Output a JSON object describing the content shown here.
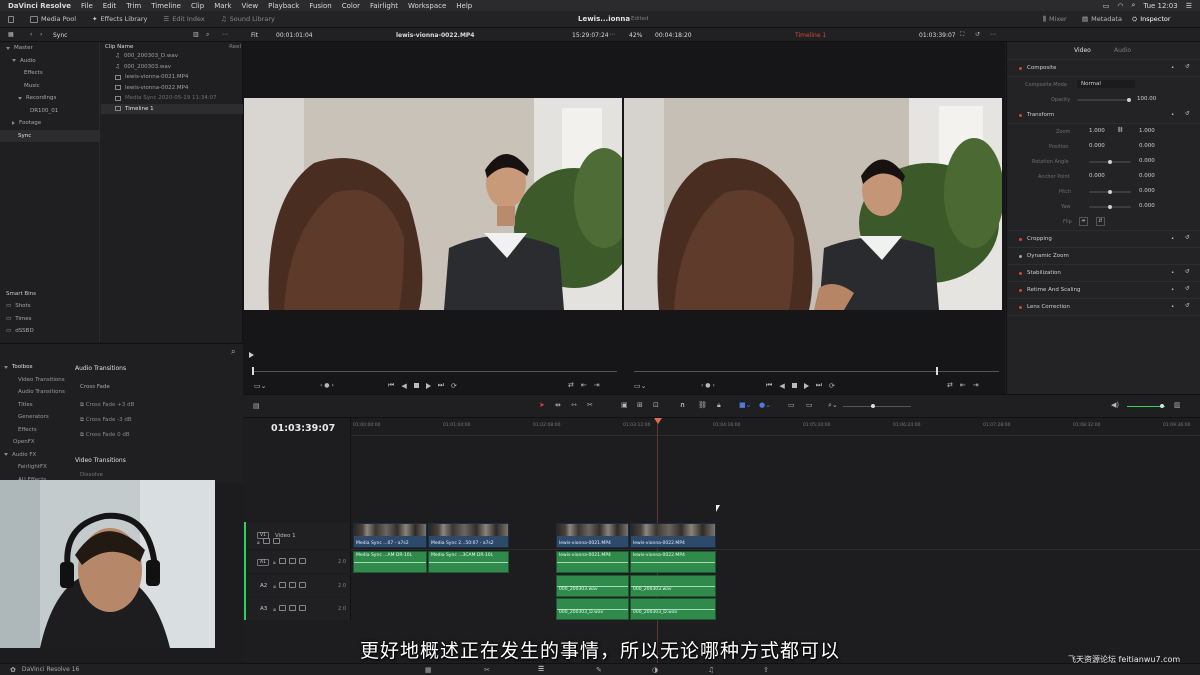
{
  "menubar": {
    "app_name": "DaVinci Resolve",
    "items": [
      "File",
      "Edit",
      "Trim",
      "Timeline",
      "Clip",
      "Mark",
      "View",
      "Playback",
      "Fusion",
      "Color",
      "Fairlight",
      "Workspace",
      "Help"
    ],
    "clock": "Tue 12:03"
  },
  "toolbar": {
    "media_pool": "Media Pool",
    "effects_library": "Effects Library",
    "edit_index": "Edit Index",
    "sound_library": "Sound Library",
    "project_title": "Lewis...ionna",
    "project_status": "Edited",
    "mixer": "Mixer",
    "metadata": "Metadata",
    "inspector": "Inspector"
  },
  "viewerbar": {
    "bin_name": "Sync",
    "fit": "Fit",
    "source_tc_left": "00:01:01:04",
    "source_clip": "lewis-vionna-0022.MP4",
    "source_tc_right": "15:29:07:24",
    "zoom": "42%",
    "duration": "00:04:18:20",
    "timeline_name": "Timeline 1",
    "program_tc": "01:03:39:07"
  },
  "bins": {
    "items": [
      {
        "label": "Master",
        "depth": 0,
        "expanded": true
      },
      {
        "label": "Audio",
        "depth": 1,
        "expanded": true
      },
      {
        "label": "Effects",
        "depth": 2
      },
      {
        "label": "Music",
        "depth": 2
      },
      {
        "label": "Recordings",
        "depth": 2,
        "expanded": true
      },
      {
        "label": "DR100_01",
        "depth": 3
      },
      {
        "label": "Footage",
        "depth": 1
      },
      {
        "label": "Sync",
        "depth": 1,
        "selected": true
      }
    ],
    "smart_bins_label": "Smart Bins",
    "smart_bins": [
      "Shots",
      "Times",
      "dSSBD"
    ]
  },
  "cliplist": {
    "header_name": "Clip Name",
    "header_reel": "Reel",
    "clips": [
      "000_200303_D.wav",
      "000_200303.wav",
      "lewis-vionna-0021.MP4",
      "lewis-vionna-0022.MP4",
      "Media Sync 2020-05-19 11:34:07",
      "Timeline 1"
    ]
  },
  "toolbox": {
    "tree": [
      {
        "label": "Toolbox",
        "expanded": true
      },
      {
        "label": "Video Transitions",
        "depth": 1
      },
      {
        "label": "Audio Transitions",
        "depth": 1
      },
      {
        "label": "Titles",
        "depth": 1
      },
      {
        "label": "Generators",
        "depth": 1
      },
      {
        "label": "Effects",
        "depth": 1
      },
      {
        "label": "OpenFX",
        "depth": 0
      },
      {
        "label": "Audio FX",
        "depth": 0,
        "expanded": true
      },
      {
        "label": "FairlightFX",
        "depth": 1
      },
      {
        "label": "AU Effects",
        "depth": 1
      }
    ],
    "audio_transitions_title": "Audio Transitions",
    "audio_transitions": [
      "Cross Fade",
      "Cross Fade +3 dB",
      "Cross Fade -3 dB",
      "Cross Fade 0 dB"
    ],
    "video_transitions_title": "Video Transitions",
    "video_transitions_first": "Dissolve"
  },
  "inspector": {
    "tab_video": "Video",
    "tab_audio": "Audio",
    "composite": "Composite",
    "composite_mode_label": "Composite Mode",
    "composite_mode": "Normal",
    "opacity_label": "Opacity",
    "opacity": "100.00",
    "transform": "Transform",
    "zoom_label": "Zoom",
    "zoom_x": "1.000",
    "zoom_y": "1.000",
    "position_label": "Position",
    "position_x": "0.000",
    "position_y": "0.000",
    "rotation_label": "Rotation Angle",
    "rotation": "0.000",
    "anchor_label": "Anchor Point",
    "anchor_x": "0.000",
    "anchor_y": "0.000",
    "pitch_label": "Pitch",
    "pitch": "0.000",
    "yaw_label": "Yaw",
    "yaw": "0.000",
    "flip_label": "Flip",
    "sections": [
      "Cropping",
      "Dynamic Zoom",
      "Stabilization",
      "Retime And Scaling",
      "Lens Correction"
    ]
  },
  "timeline": {
    "timecode": "01:03:39:07",
    "ruler": [
      "01:00:00:00",
      "01:01:04:00",
      "01:02:08:00",
      "01:03:12:00",
      "01:04:16:00",
      "01:05:20:00",
      "01:06:24:00",
      "01:07:28:00",
      "01:08:32:00",
      "01:09:36:00"
    ],
    "video_track": {
      "badge": "V1",
      "name": "Video 1"
    },
    "audio_tracks": [
      {
        "badge": "A1",
        "name": "",
        "level": "2.0"
      },
      {
        "badge": "A2",
        "name": "",
        "level": "2.0"
      },
      {
        "badge": "A3",
        "name": "",
        "level": "2.0"
      }
    ],
    "video_clips": [
      "Media Sync ...07 - a7s2",
      "Media Sync 2...50:07 - a7s2",
      "lewis-vionna-0021.MP4",
      "lewis-vionna-0022.MP4"
    ],
    "a1_clips": [
      "Media Sync ...AM DR-10L",
      "Media Sync ...3CAM DR-10L",
      "lewis-vionna-0021.MP4",
      "lewis-vionna-0022.MP4"
    ],
    "a2_clips": [
      "000_200303.wav",
      "000_200303.wav"
    ],
    "a3_clips": [
      "000_200303_D.wav",
      "000_200303_D.wav"
    ]
  },
  "bottombar": {
    "app_label": "DaVinci Resolve 16"
  },
  "subtitle": "更好地概述正在发生的事情，所以无论哪种方式都可以",
  "watermark": "飞天资源论坛 feitianwu7.com",
  "colors": {
    "accent_red": "#d6453a",
    "clip_blue": "#2d4a6b",
    "clip_green": "#2f8a4c",
    "playhead": "#e26a55"
  }
}
